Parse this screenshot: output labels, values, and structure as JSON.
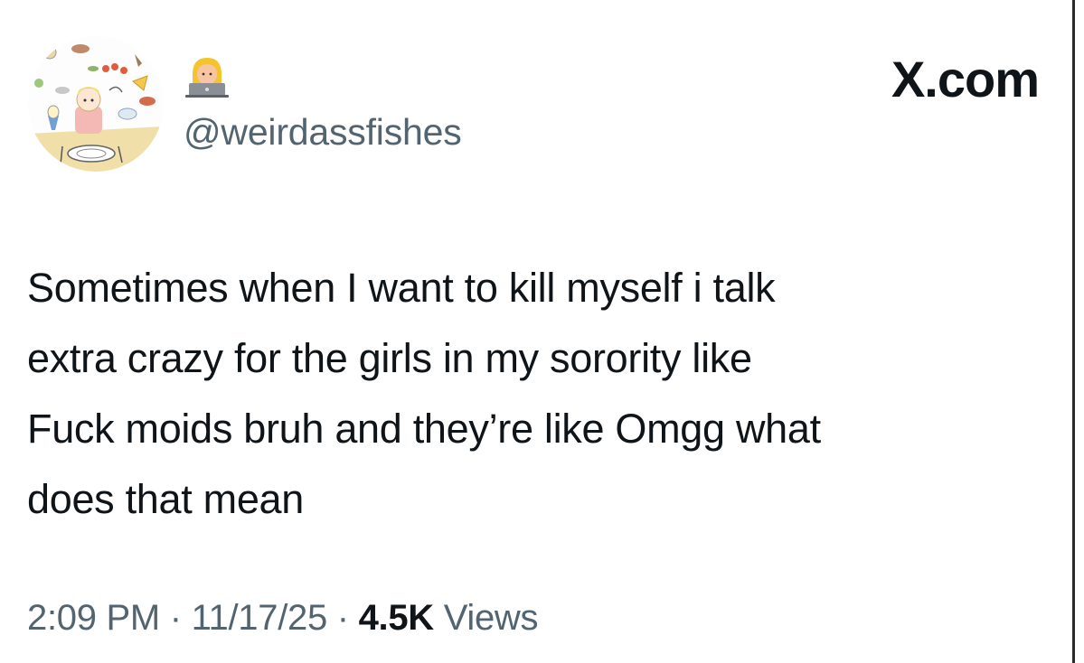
{
  "header": {
    "brand": "X.com",
    "display_name_icon": "woman-technologist-emoji",
    "handle": "@weirdassfishes",
    "avatar_icon": "avatar-illustration"
  },
  "tweet": {
    "lines": [
      "Sometimes when I want to kill myself i talk",
      "extra crazy for the girls in my sorority like",
      "Fuck moids bruh and they’re like Omgg what",
      "does that mean"
    ]
  },
  "meta": {
    "time": "2:09 PM",
    "separator": "·",
    "date": "11/17/25",
    "views_count": "4.5K",
    "views_label": "Views"
  }
}
